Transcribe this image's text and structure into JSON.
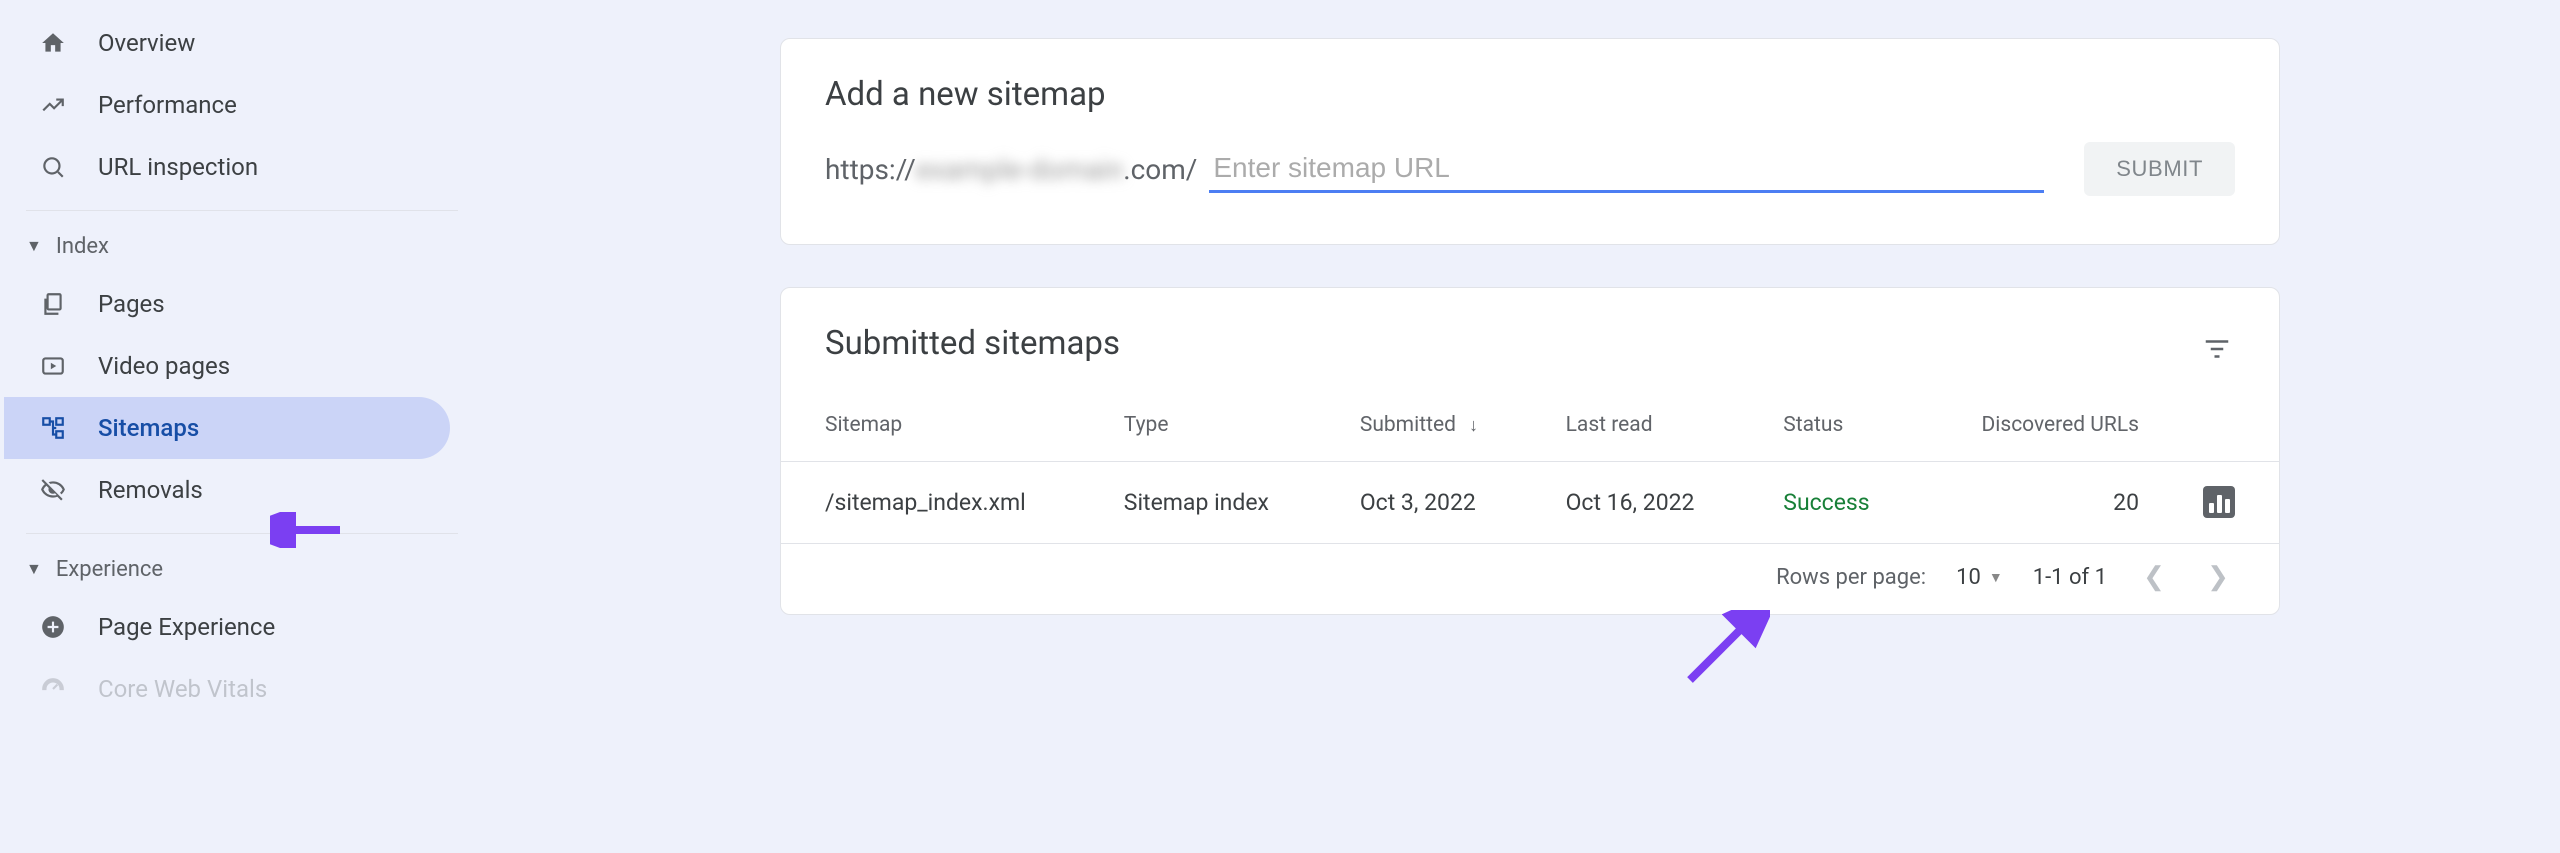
{
  "sidebar": {
    "items": [
      {
        "label": "Overview"
      },
      {
        "label": "Performance"
      },
      {
        "label": "URL inspection"
      }
    ],
    "sections": [
      {
        "header": "Index",
        "items": [
          {
            "label": "Pages"
          },
          {
            "label": "Video pages"
          },
          {
            "label": "Sitemaps",
            "active": true
          },
          {
            "label": "Removals"
          }
        ]
      },
      {
        "header": "Experience",
        "items": [
          {
            "label": "Page Experience"
          },
          {
            "label": "Core Web Vitals"
          }
        ]
      }
    ]
  },
  "add_card": {
    "title": "Add a new sitemap",
    "base_url_prefix": "https://",
    "base_url_hidden": "example-domain",
    "base_url_suffix": ".com/",
    "placeholder": "Enter sitemap URL",
    "submit_label": "SUBMIT"
  },
  "table_card": {
    "title": "Submitted sitemaps",
    "columns": {
      "sitemap": "Sitemap",
      "type": "Type",
      "submitted": "Submitted",
      "last_read": "Last read",
      "status": "Status",
      "discovered": "Discovered URLs"
    },
    "sort_column": "submitted",
    "rows": [
      {
        "sitemap": "/sitemap_index.xml",
        "type": "Sitemap index",
        "submitted": "Oct 3, 2022",
        "last_read": "Oct 16, 2022",
        "status": "Success",
        "discovered": "20"
      }
    ],
    "pager": {
      "rows_label": "Rows per page:",
      "rows_value": "10",
      "range": "1-1 of 1"
    }
  }
}
